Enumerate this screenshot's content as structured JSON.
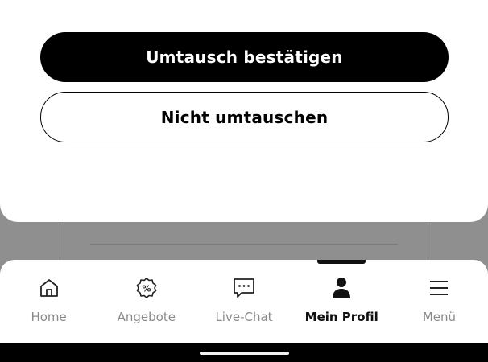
{
  "sheet": {
    "confirm_label": "Umtausch bestätigen",
    "decline_label": "Nicht umtauschen"
  },
  "nav": {
    "items": [
      {
        "label": "Home",
        "icon": "home-icon",
        "active": false
      },
      {
        "label": "Angebote",
        "icon": "percent-badge-icon",
        "active": false
      },
      {
        "label": "Live-Chat",
        "icon": "chat-bubble-icon",
        "active": false
      },
      {
        "label": "Mein Profil",
        "icon": "person-icon",
        "active": true
      },
      {
        "label": "Menü",
        "icon": "hamburger-menu-icon",
        "active": false
      }
    ]
  },
  "colors": {
    "primary": "#000000",
    "surface": "#ffffff",
    "scrim": "#8f8f8f",
    "inactive_label": "#8a8a8a"
  }
}
